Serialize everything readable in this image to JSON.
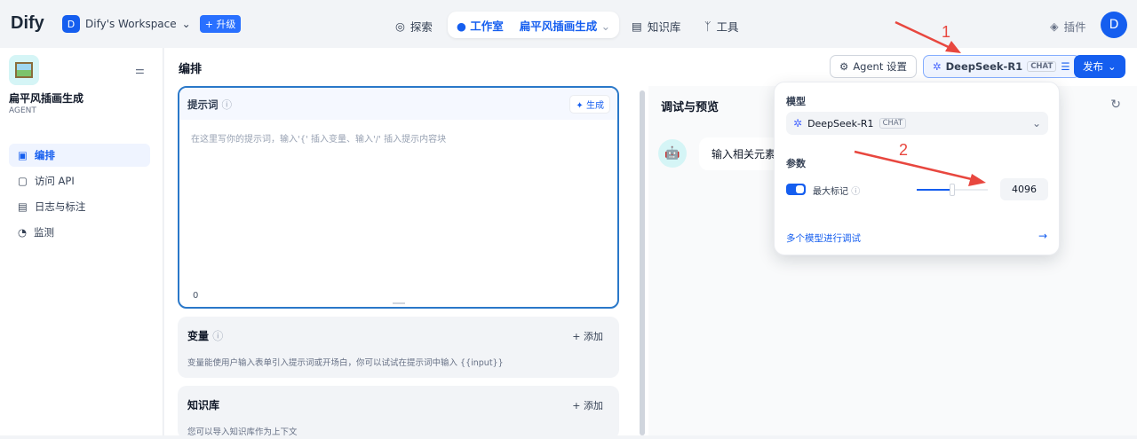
{
  "topbar": {
    "logo": "Dify",
    "workspace_initial": "D",
    "workspace": "Dify's Workspace",
    "upgrade": "+ 升级",
    "explore": "探索",
    "studio": "工作室",
    "current_app": "扁平风插画生成",
    "knowledge": "知识库",
    "tools": "工具",
    "plugins": "插件",
    "user_initial": "D"
  },
  "sidebar": {
    "app_name": "扁平风插画生成",
    "app_type": "AGENT",
    "items": [
      {
        "label": "编排"
      },
      {
        "label": "访问 API"
      },
      {
        "label": "日志与标注"
      },
      {
        "label": "监测"
      }
    ]
  },
  "main": {
    "title": "编排",
    "agent_settings": "Agent 设置",
    "model_name": "DeepSeek-R1",
    "model_tag": "CHAT",
    "publish": "发布",
    "prompt": {
      "label": "提示词",
      "generate": "生成",
      "placeholder": "在这里写你的提示词，输入'{' 插入变量、输入'/' 插入提示内容块",
      "count": "0"
    },
    "variables": {
      "label": "变量",
      "add": "+ 添加",
      "desc": "变量能使用户输入表单引入提示词或开场白，你可以试试在提示词中输入 {{input}}"
    },
    "knowledge": {
      "label": "知识库",
      "add": "+ 添加",
      "desc": "您可以导入知识库作为上下文"
    }
  },
  "debug": {
    "title": "调试与预览",
    "input_hint": "输入相关元素"
  },
  "popover": {
    "model_label": "模型",
    "model_name": "DeepSeek-R1",
    "model_tag": "CHAT",
    "params_label": "参数",
    "max_tokens_label": "最大标记",
    "max_tokens_enabled": true,
    "max_tokens_value": "4096",
    "slider_fraction": 0.5,
    "multi_model": "多个模型进行调试"
  },
  "annotations": {
    "arrow1": "1",
    "arrow2": "2",
    "color": "#e8473f"
  }
}
